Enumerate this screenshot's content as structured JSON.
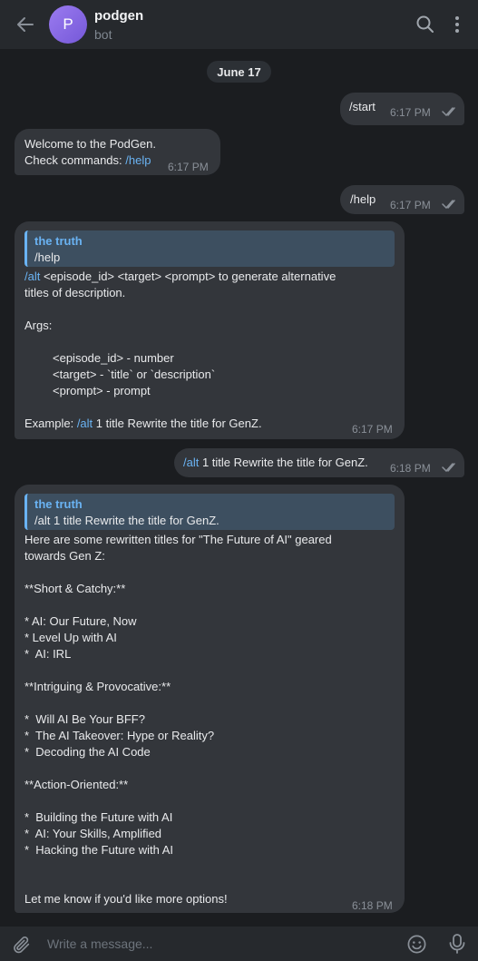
{
  "header": {
    "avatar_letter": "P",
    "title": "podgen",
    "subtitle": "bot"
  },
  "date_separator": "June 17",
  "messages": {
    "m1": {
      "text": "/start",
      "time": "6:17 PM"
    },
    "m2": {
      "line1": "Welcome to the PodGen.",
      "line2_prefix": "Check commands: ",
      "line2_cmd": "/help",
      "time": "6:17 PM"
    },
    "m3": {
      "text": "/help",
      "time": "6:17 PM"
    },
    "m4": {
      "reply_name": "the truth",
      "reply_text": "/help",
      "l1_cmd": "/alt",
      "l1_rest": " <episode_id> <target> <prompt> to generate alternative",
      "l2": "titles of description.",
      "l3": "Args:",
      "l4": "<episode_id> - number",
      "l5": "<target> - `title` or `description`",
      "l6": "<prompt> - prompt",
      "l7_prefix": "Example: ",
      "l7_cmd": "/alt",
      "l7_rest": " 1 title Rewrite the title for GenZ.",
      "time": "6:17 PM"
    },
    "m5": {
      "cmd": "/alt",
      "rest": " 1 title Rewrite the title for GenZ.",
      "time": "6:18 PM"
    },
    "m6": {
      "reply_name": "the truth",
      "reply_text": "/alt 1 title Rewrite the title for GenZ.",
      "lines": [
        "Here are some rewritten titles for \"The Future of AI\" geared",
        "towards Gen Z:",
        "",
        "**Short & Catchy:**",
        "",
        "* AI: Our Future, Now",
        "* Level Up with AI",
        "*  AI: IRL",
        "",
        "**Intriguing & Provocative:**",
        "",
        "*  Will AI Be Your BFF?",
        "*  The AI Takeover: Hype or Reality?",
        "*  Decoding the AI Code",
        "",
        "**Action-Oriented:**",
        "",
        "*  Building the Future with AI",
        "*  AI: Your Skills, Amplified",
        "*  Hacking the Future with AI",
        "",
        "",
        "Let me know if you'd like more options!"
      ],
      "time": "6:18 PM"
    }
  },
  "composer": {
    "placeholder": "Write a message..."
  }
}
